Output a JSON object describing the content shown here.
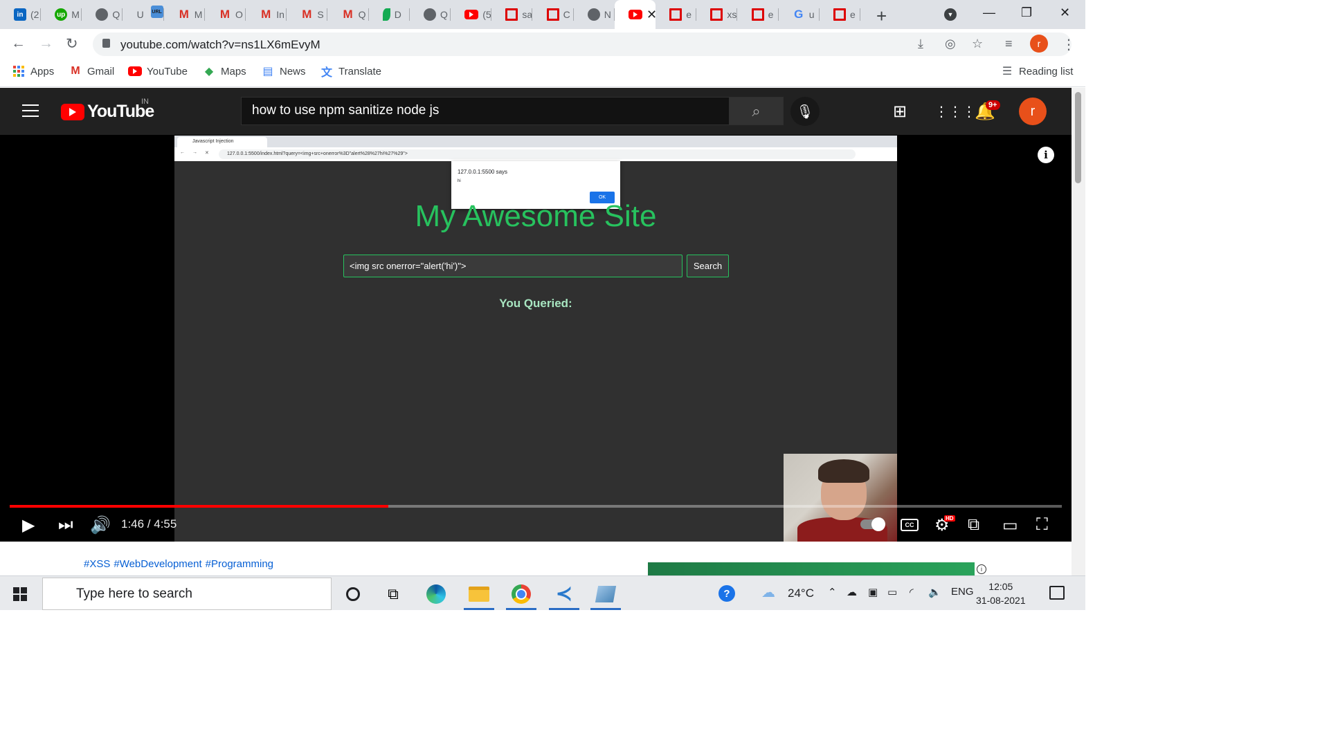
{
  "browser": {
    "tabs": [
      {
        "label": "(2",
        "icon": "linkedin-icon",
        "fav": "li",
        "glyph": "in"
      },
      {
        "label": "M",
        "icon": "upwork-icon",
        "fav": "up",
        "glyph": "up"
      },
      {
        "label": "Q",
        "icon": "globe-icon",
        "fav": "globe",
        "glyph": ""
      },
      {
        "label": "U",
        "icon": "url-shortener-icon",
        "fav": "url",
        "glyph": "URL"
      },
      {
        "label": "M",
        "icon": "gmail-icon",
        "fav": "gm",
        "glyph": "M"
      },
      {
        "label": "O",
        "icon": "gmail-icon",
        "fav": "gm",
        "glyph": "M"
      },
      {
        "label": "In",
        "icon": "gmail-icon",
        "fav": "gm",
        "glyph": "M"
      },
      {
        "label": "S",
        "icon": "gmail-icon",
        "fav": "gm",
        "glyph": "M"
      },
      {
        "label": "Q",
        "icon": "gmail-icon",
        "fav": "gm",
        "glyph": "M"
      },
      {
        "label": "D",
        "icon": "mongodb-leaf-icon",
        "fav": "leaf",
        "glyph": ""
      },
      {
        "label": "Q",
        "icon": "globe-icon",
        "fav": "globe",
        "glyph": ""
      },
      {
        "label": "(5",
        "icon": "youtube-icon",
        "fav": "yt",
        "glyph": ""
      },
      {
        "label": "sa",
        "icon": "red-square-icon",
        "fav": "rd",
        "glyph": ""
      },
      {
        "label": "C",
        "icon": "red-square-icon",
        "fav": "rd",
        "glyph": ""
      },
      {
        "label": "N",
        "icon": "globe-icon",
        "fav": "globe",
        "glyph": ""
      },
      {
        "label": "",
        "icon": "youtube-icon",
        "fav": "yt",
        "glyph": "",
        "active": true
      },
      {
        "label": "e",
        "icon": "red-square-icon",
        "fav": "rd",
        "glyph": ""
      },
      {
        "label": "xs",
        "icon": "red-square-icon",
        "fav": "rd",
        "glyph": ""
      },
      {
        "label": "e",
        "icon": "red-square-icon",
        "fav": "rd",
        "glyph": ""
      },
      {
        "label": "u",
        "icon": "google-icon",
        "fav": "gg",
        "glyph": "G"
      },
      {
        "label": "e",
        "icon": "red-square-icon",
        "fav": "rd",
        "glyph": ""
      }
    ],
    "url": "youtube.com/watch?v=ns1LX6mEvyM",
    "profile_initial": "r",
    "bookmarks": [
      {
        "label": "Apps",
        "icon": "apps-grid-icon"
      },
      {
        "label": "Gmail",
        "icon": "gmail-icon"
      },
      {
        "label": "YouTube",
        "icon": "youtube-icon"
      },
      {
        "label": "Maps",
        "icon": "maps-icon"
      },
      {
        "label": "News",
        "icon": "news-icon"
      },
      {
        "label": "Translate",
        "icon": "translate-icon"
      }
    ],
    "reading_list": "Reading list"
  },
  "youtube": {
    "logo_text": "YouTube",
    "country_code": "IN",
    "search_query": "how to use npm sanitize node js",
    "notification_badge": "9+",
    "avatar_initial": "r",
    "time_display": "1:46 / 4:55",
    "progress_fraction": 0.36,
    "hashtags": [
      "#XSS",
      "#WebDevelopment",
      "#Programming"
    ],
    "accent_color": "#ff0000"
  },
  "video_frame": {
    "inner_tab_title": "Javascript Injection",
    "inner_url": "127.0.0.1:5500/index.html?query=<img+src+onerror%3D\"alert%28%27hi%27%29\">",
    "alert_title": "127.0.0.1:5500 says",
    "alert_message": "hi",
    "alert_ok": "OK",
    "site_title": "My Awesome Site",
    "search_value": "<img src onerror=\"alert('hi')\">",
    "search_button": "Search",
    "queried_label": "You Queried:",
    "site_accent": "#27c25e"
  },
  "taskbar": {
    "search_placeholder": "Type here to search",
    "temperature": "24°C",
    "language": "ENG",
    "time": "12:05",
    "date": "31-08-2021"
  }
}
